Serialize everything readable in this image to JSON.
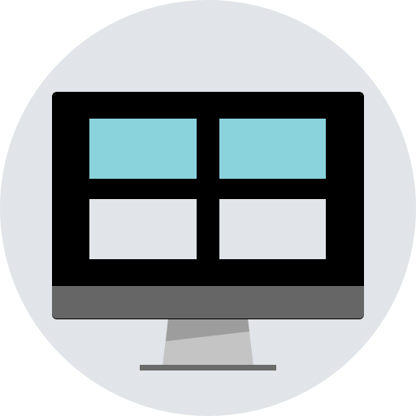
{
  "icon": {
    "name": "desktop-monitor-icon",
    "colors": {
      "background_circle": "#E1E4E8",
      "monitor_frame": "#000000",
      "bezel": "#666666",
      "tile_highlight": "#8AD3DC",
      "tile_plain": "#E1E4E8",
      "stand_dark": "#9D9D9D",
      "stand_light": "#C4C4C4",
      "base": "#6B6B6B"
    },
    "tiles": [
      {
        "row": 1,
        "col": 1,
        "state": "highlight"
      },
      {
        "row": 1,
        "col": 2,
        "state": "highlight"
      },
      {
        "row": 2,
        "col": 1,
        "state": "plain"
      },
      {
        "row": 2,
        "col": 2,
        "state": "plain"
      }
    ]
  }
}
